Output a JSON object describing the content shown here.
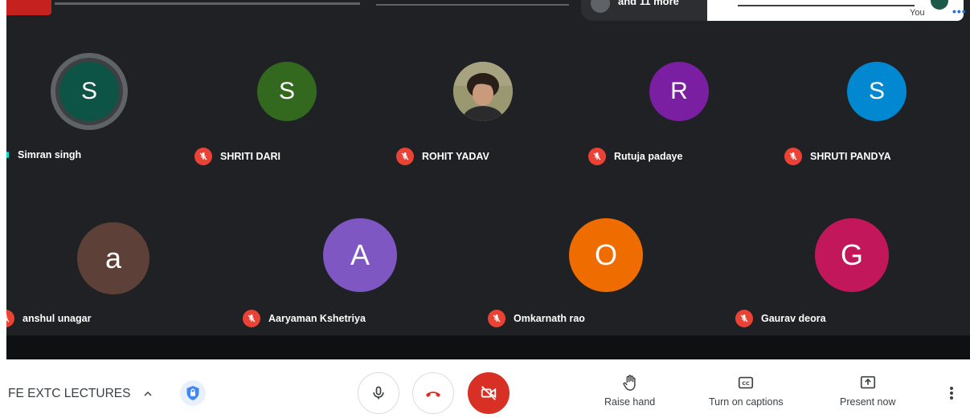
{
  "top": {
    "more_label": "and 11 more",
    "self_label": "You"
  },
  "participants": [
    {
      "name": "Simran singh",
      "initial": "S",
      "color": "#0d5446",
      "speaking": true,
      "muted": false
    },
    {
      "name": "SHRITI DARI",
      "initial": "S",
      "color": "#33691e",
      "muted": true
    },
    {
      "name": "ROHIT YADAV",
      "initial": "",
      "photo": true,
      "muted": true
    },
    {
      "name": "Rutuja padaye",
      "initial": "R",
      "color": "#7b1fa2",
      "muted": true
    },
    {
      "name": "SHRUTI PANDYA",
      "initial": "S",
      "color": "#0288d1",
      "muted": true
    },
    {
      "name": "anshul unagar",
      "initial": "a",
      "color": "#5d4037",
      "muted": true
    },
    {
      "name": "Aaryaman Kshetriya",
      "initial": "A",
      "color": "#7e57c2",
      "muted": true
    },
    {
      "name": "Omkarnath rao",
      "initial": "O",
      "color": "#ef6c00",
      "muted": true
    },
    {
      "name": "Gaurav deora",
      "initial": "G",
      "color": "#c2185b",
      "muted": true
    }
  ],
  "controls": {
    "meeting_name": "FE EXTC LECTURES",
    "raise_hand": "Raise hand",
    "captions": "Turn on captions",
    "present": "Present now"
  },
  "colors": {
    "stage_bg": "#202124",
    "mute_red": "#ea4335",
    "end_call_red": "#d93025",
    "accent_blue": "#1a73e8"
  },
  "icons": [
    "microphone-icon",
    "end-call-icon",
    "camera-off-icon",
    "raise-hand-icon",
    "captions-icon",
    "present-icon",
    "lock-icon",
    "chevron-up-icon",
    "more-vert-icon",
    "mic-off-icon"
  ]
}
